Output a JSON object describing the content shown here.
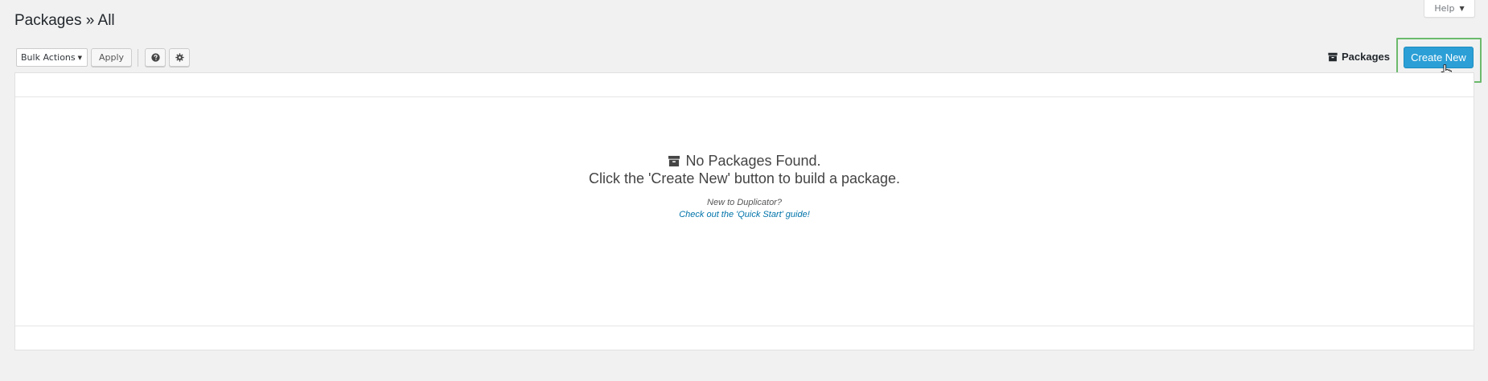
{
  "header": {
    "title": "Packages » All",
    "help_label": "Help"
  },
  "toolbar": {
    "bulk_actions": {
      "selected": "Bulk Actions"
    },
    "apply_label": "Apply",
    "help_icon": "question-circle-icon",
    "settings_icon": "gear-icon"
  },
  "right_actions": {
    "packages_label": "Packages",
    "packages_icon": "archive-icon",
    "create_new_label": "Create New"
  },
  "empty_state": {
    "title": "No Packages Found.",
    "subtitle": "Click the 'Create New' button to build a package.",
    "new_to": "New to Duplicator?",
    "guide_link": "Check out the 'Quick Start' guide!",
    "icon": "archive-icon"
  },
  "colors": {
    "primary_button": "#2c9fd6",
    "highlight_outline": "#6cba6c",
    "link": "#0073aa"
  }
}
